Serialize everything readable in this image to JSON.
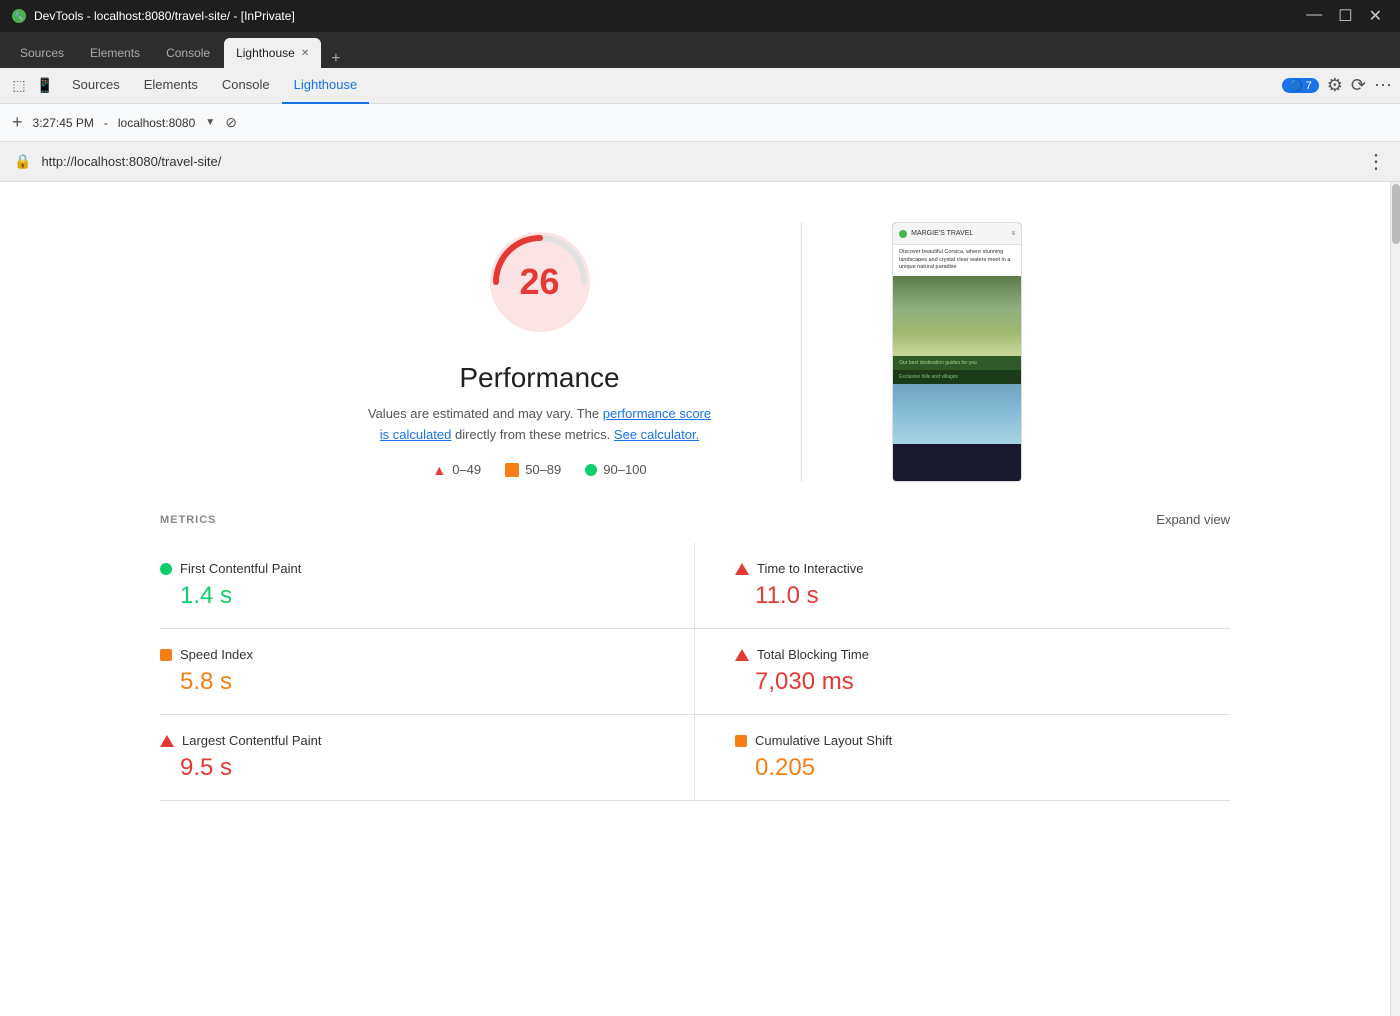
{
  "titlebar": {
    "title": "DevTools - localhost:8080/travel-site/ - [InPrivate]",
    "controls": {
      "minimize": "—",
      "maximize": "☐",
      "close": "✕"
    }
  },
  "tabs": [
    {
      "id": "sources",
      "label": "Sources",
      "active": false
    },
    {
      "id": "elements",
      "label": "Elements",
      "active": false
    },
    {
      "id": "console",
      "label": "Console",
      "active": false
    },
    {
      "id": "lighthouse",
      "label": "Lighthouse",
      "active": true
    },
    {
      "id": "new",
      "label": "+",
      "active": false
    }
  ],
  "toolbar": {
    "time": "3:27:45 PM",
    "url_display": "localhost:8080",
    "notification_count": "7",
    "nav_tabs": [
      "Sources",
      "Elements",
      "Console",
      "Lighthouse"
    ]
  },
  "address_bar": {
    "url": "http://localhost:8080/travel-site/"
  },
  "performance": {
    "score": "26",
    "title": "Performance",
    "description": "Values are estimated and may vary. The",
    "link1_text": "performance score\nis calculated",
    "description2": "directly from these metrics.",
    "link2_text": "See calculator.",
    "legend": {
      "poor_range": "0–49",
      "needs_improvement_range": "50–89",
      "good_range": "90–100"
    }
  },
  "metrics": {
    "section_label": "METRICS",
    "expand_label": "Expand view",
    "items": [
      {
        "id": "fcp",
        "name": "First Contentful Paint",
        "value": "1.4 s",
        "status": "green"
      },
      {
        "id": "tti",
        "name": "Time to Interactive",
        "value": "11.0 s",
        "status": "red"
      },
      {
        "id": "si",
        "name": "Speed Index",
        "value": "5.8 s",
        "status": "orange"
      },
      {
        "id": "tbt",
        "name": "Total Blocking Time",
        "value": "7,030 ms",
        "status": "red"
      },
      {
        "id": "lcp",
        "name": "Largest Contentful Paint",
        "value": "9.5 s",
        "status": "red"
      },
      {
        "id": "cls",
        "name": "Cumulative Layout Shift",
        "value": "0.205",
        "status": "orange"
      }
    ]
  },
  "screenshot": {
    "site_name": "MARGIE'S TRAVEL",
    "hero_text": "Discover beautiful Corsica, where stunning landscapes and crystal clear waters meet in a unique natural paradise",
    "bottom_text": "Our best destination guides for you",
    "footer_text": "Exclusive hills and villages"
  }
}
